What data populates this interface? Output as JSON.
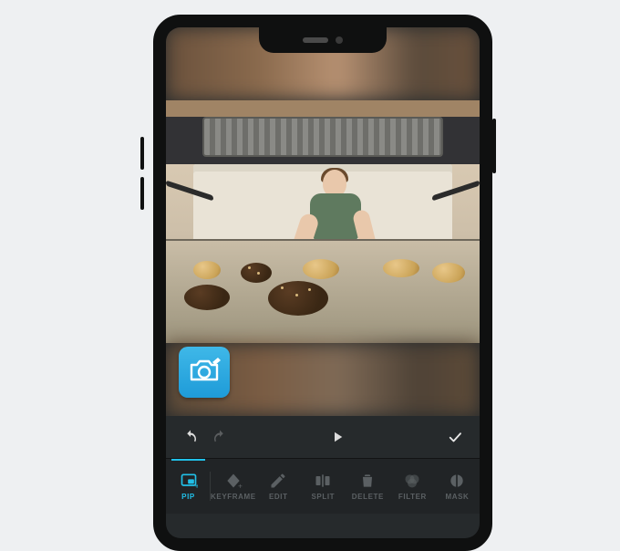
{
  "colors": {
    "accent": "#21c0e8",
    "disabled": "#5b6063",
    "badge": "#1e9bd8"
  },
  "scene_description": "Inside an oven view of cookies on a tray while a person looks in",
  "playback": {
    "undo_icon": "undo",
    "redo_icon": "redo",
    "play_icon": "play",
    "confirm_icon": "check"
  },
  "badge": {
    "icon": "camera-eraser"
  },
  "toolbar": {
    "items": [
      {
        "id": "pip",
        "label": "PIP",
        "icon": "pip-icon",
        "active": true
      },
      {
        "id": "keyframe",
        "label": "KEYFRAME",
        "icon": "keyframe-icon",
        "active": false
      },
      {
        "id": "edit",
        "label": "EDIT",
        "icon": "edit-icon",
        "active": false
      },
      {
        "id": "split",
        "label": "SPLIT",
        "icon": "split-icon",
        "active": false
      },
      {
        "id": "delete",
        "label": "DELETE",
        "icon": "delete-icon",
        "active": false
      },
      {
        "id": "filter",
        "label": "FILTER",
        "icon": "filter-icon",
        "active": false
      },
      {
        "id": "mask",
        "label": "MASK",
        "icon": "mask-icon",
        "active": false
      }
    ]
  }
}
